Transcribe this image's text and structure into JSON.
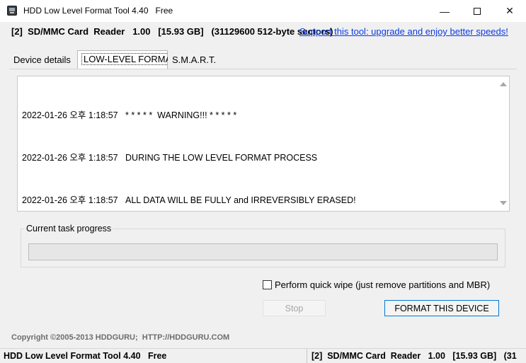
{
  "window": {
    "title": "HDD Low Level Format Tool 4.40   Free",
    "min_glyph": "—",
    "close_glyph": "✕"
  },
  "header": {
    "device_info": "[2]  SD/MMC Card  Reader   1.00   [15.93 GB]   (31129600 512-byte sectors)",
    "support_link": "Support this tool: upgrade and enjoy better speeds!"
  },
  "tabs": [
    {
      "label": "Device details"
    },
    {
      "label": "LOW-LEVEL FORMAT"
    },
    {
      "label": "S.M.A.R.T."
    }
  ],
  "log": {
    "lines": [
      "2022-01-26 오후 1:18:57   * * * * *  WARNING!!! * * * * *",
      "2022-01-26 오후 1:18:57   DURING THE LOW LEVEL FORMAT PROCESS",
      "2022-01-26 오후 1:18:57   ALL DATA WILL BE FULLY and IRREVERSIBLY ERASED!"
    ]
  },
  "progress": {
    "label": "Current task progress",
    "value": 0
  },
  "options": {
    "quick_wipe_label": "Perform quick wipe (just remove partitions and MBR)",
    "quick_wipe_checked": false
  },
  "buttons": {
    "stop": "Stop",
    "format": "FORMAT THIS DEVICE"
  },
  "footer": {
    "copyright": "Copyright ©2005-2013 HDDGURU;  HTTP://HDDGURU.COM"
  },
  "statusbar": {
    "left": "HDD Low Level Format Tool 4.40   Free",
    "right": "[2]  SD/MMC Card  Reader   1.00   [15.93 GB]   (31"
  },
  "colors": {
    "link": "#0b3be0",
    "focus_border": "#0078d7"
  }
}
